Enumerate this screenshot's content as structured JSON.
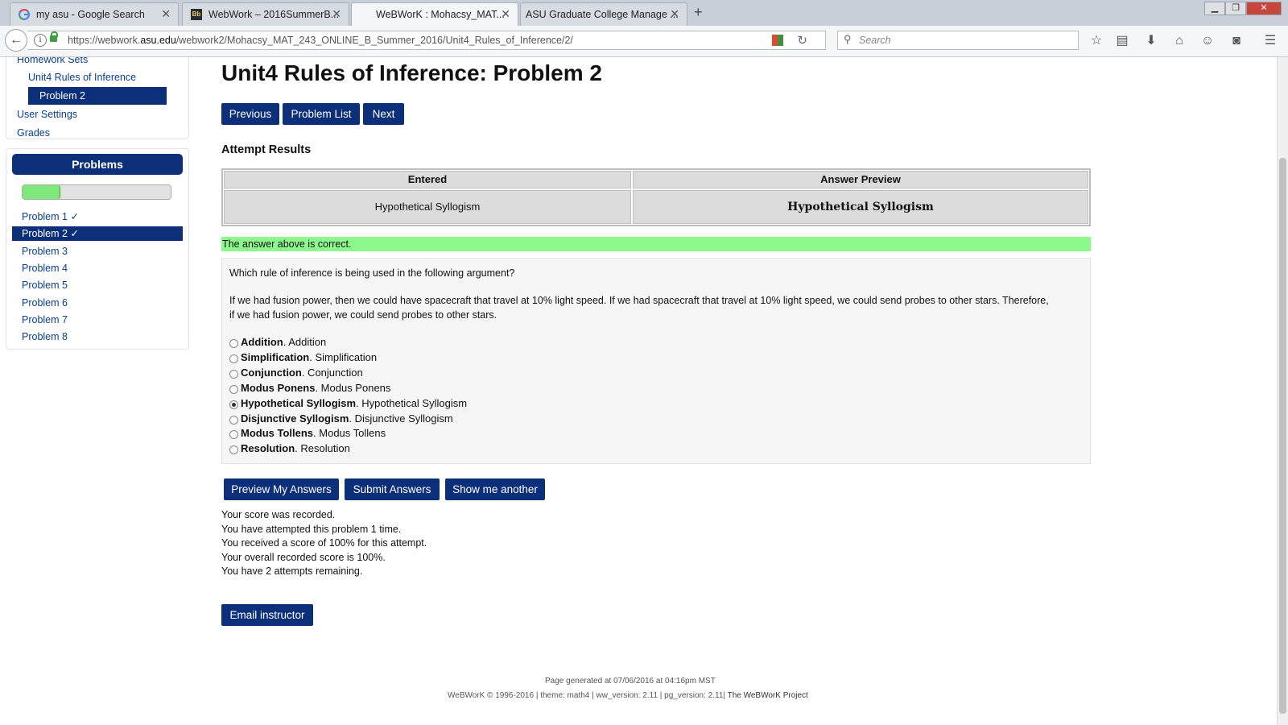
{
  "browser": {
    "tabs": [
      {
        "title": "my asu - Google Search",
        "favicon": "google-g-icon"
      },
      {
        "title": "WebWork – 2016SummerB...",
        "favicon": "blackboard-icon"
      },
      {
        "title": "WeBWorK : Mohacsy_MAT...",
        "favicon": "none",
        "active": true
      },
      {
        "title": "ASU Graduate College Manage ...",
        "favicon": "none"
      }
    ],
    "url_prefix": "https://webwork.",
    "url_domain": "asu.edu",
    "url_path": "/webwork2/Mohacsy_MAT_243_ONLINE_B_Summer_2016/Unit4_Rules_of_Inference/2/",
    "search_placeholder": "Search"
  },
  "sidebar": {
    "homework_sets": "Homework Sets",
    "set_link": "Unit4 Rules of Inference",
    "problem_link": "Problem 2",
    "user_settings": "User Settings",
    "grades": "Grades",
    "problems_header": "Problems",
    "progress_fraction": 0.25,
    "problems": [
      {
        "label": "Problem 1 ✓",
        "selected": false
      },
      {
        "label": "Problem 2 ✓",
        "selected": true
      },
      {
        "label": "Problem 3",
        "selected": false
      },
      {
        "label": "Problem 4",
        "selected": false
      },
      {
        "label": "Problem 5",
        "selected": false
      },
      {
        "label": "Problem 6",
        "selected": false
      },
      {
        "label": "Problem 7",
        "selected": false
      },
      {
        "label": "Problem 8",
        "selected": false
      }
    ]
  },
  "main": {
    "title": "Unit4 Rules of Inference: Problem 2",
    "nav_buttons": {
      "previous": "Previous",
      "problem_list": "Problem List",
      "next": "Next"
    },
    "attempt_results_heading": "Attempt Results",
    "results_table": {
      "col_entered": "Entered",
      "col_preview": "Answer Preview",
      "entered_value": "Hypothetical Syllogism",
      "preview_value": "Hypothetical Syllogism"
    },
    "correct_message": "The answer above is correct.",
    "question": "Which rule of inference is being used in the following argument?",
    "argument_line1": "If we had fusion power, then we could have spacecraft that travel at 10% light speed. If we had spacecraft that travel at 10% light speed, we could send probes to other stars. Therefore,",
    "argument_line2": "if we had fusion power, we could send probes to other stars.",
    "options": [
      {
        "bold": "Addition",
        "rest": ". Addition",
        "checked": false
      },
      {
        "bold": "Simplification",
        "rest": ". Simplification",
        "checked": false
      },
      {
        "bold": "Conjunction",
        "rest": ". Conjunction",
        "checked": false
      },
      {
        "bold": "Modus Ponens",
        "rest": ". Modus Ponens",
        "checked": false
      },
      {
        "bold": "Hypothetical Syllogism",
        "rest": ". Hypothetical Syllogism",
        "checked": true
      },
      {
        "bold": "Disjunctive Syllogism",
        "rest": ". Disjunctive Syllogism",
        "checked": false
      },
      {
        "bold": "Modus Tollens",
        "rest": ". Modus Tollens",
        "checked": false
      },
      {
        "bold": "Resolution",
        "rest": ". Resolution",
        "checked": false
      }
    ],
    "action_buttons": {
      "preview": "Preview My Answers",
      "submit": "Submit Answers",
      "another": "Show me another"
    },
    "score_messages": [
      "Your score was recorded.",
      "You have attempted this problem 1 time.",
      "You received a score of 100% for this attempt.",
      "Your overall recorded score is 100%.",
      "You have 2 attempts remaining."
    ],
    "email_button": "Email instructor"
  },
  "footer": {
    "generated": "Page generated at 07/06/2016 at 04:16pm MST",
    "credits": "WeBWorK © 1996-2016 | theme: math4 | ww_version: 2.11 | pg_version: 2.11|",
    "project": "The WeBWorK Project"
  },
  "colors": {
    "nav_blue": "#0c2f7a",
    "correct_green": "#8bf98b",
    "progress_green": "#7fe87a"
  }
}
